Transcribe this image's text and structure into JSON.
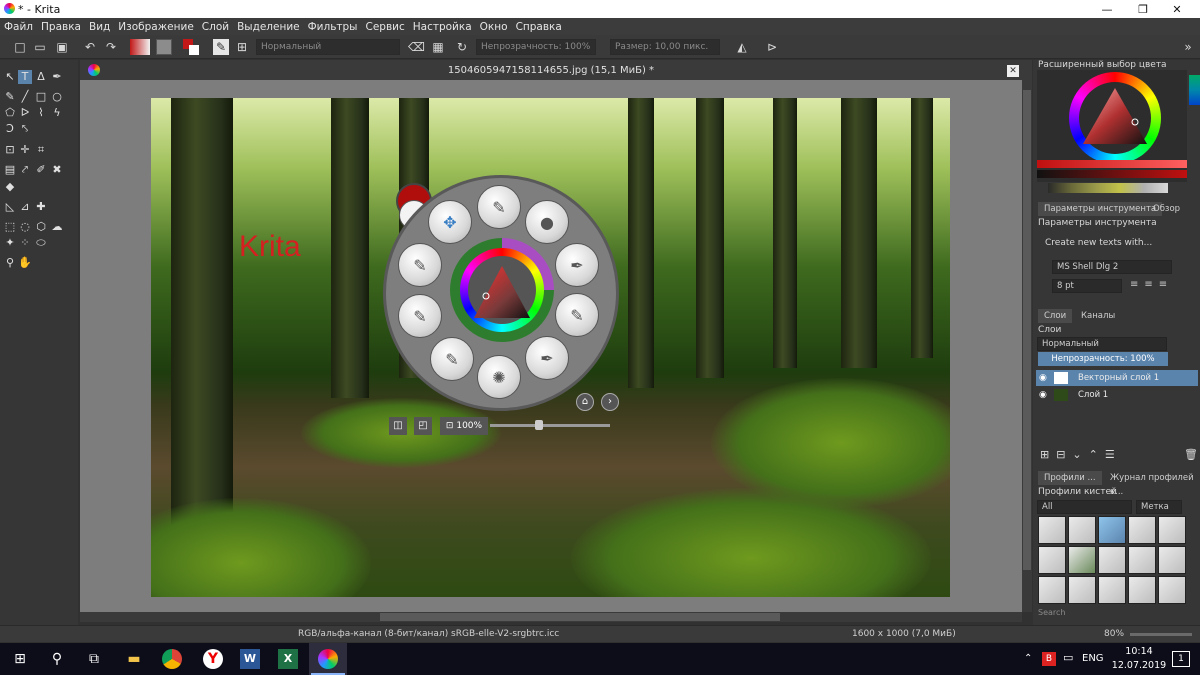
{
  "window": {
    "title": "* - Krita",
    "minimize_glyph": "—",
    "maximize_glyph": "❐",
    "close_glyph": "✕"
  },
  "menu": [
    "Файл",
    "Правка",
    "Вид",
    "Изображение",
    "Слой",
    "Выделение",
    "Фильтры",
    "Сервис",
    "Настройка",
    "Окно",
    "Справка"
  ],
  "toolbar": {
    "blend_mode": "Нормальный",
    "opacity_label": "Непрозрачность:",
    "opacity_value": "100%",
    "size_label": "Размер:",
    "size_value": "10,00 пикс."
  },
  "document": {
    "title": "1504605947158114655.jpg (15,1 МиБ) *",
    "canvas_text": "Krita"
  },
  "palette": {
    "zoom": "100%"
  },
  "docker": {
    "advanced_color_title": "Расширенный выбор цвета",
    "tabs_tool": [
      "Параметры инструмента",
      "Обзор"
    ],
    "tool_options_title": "Параметры инструмента",
    "create_text": "Create new texts with...",
    "font_name": "MS Shell Dlg 2",
    "font_size": "8 pt",
    "tabs_layers": [
      "Слои",
      "Каналы"
    ],
    "layers_title": "Слои",
    "layer_blend": "Нормальный",
    "layer_opacity": "Непрозрачность:  100%",
    "layers": [
      {
        "name": "Векторный слой 1",
        "selected": true
      },
      {
        "name": "Слой 1",
        "selected": false
      }
    ],
    "tabs_brushes": [
      "Профили ...",
      "Журнал профилей к..."
    ],
    "brush_presets_title": "Профили кистей",
    "brush_filter": "All",
    "brush_tag": "Метка",
    "search_placeholder": "Search"
  },
  "status": {
    "color_space": "RGB/альфа-канал (8-бит/канал)  sRGB-elle-V2-srgbtrc.icc",
    "dimensions": "1600 x 1000 (7,0 МиБ)",
    "zoom": "80%"
  },
  "taskbar": {
    "lang": "ENG",
    "time": "10:14",
    "date": "12.07.2019",
    "notification_count": "1"
  },
  "colors": {
    "accent_selected": "#5b84ad",
    "krita_red": "#d42020"
  }
}
